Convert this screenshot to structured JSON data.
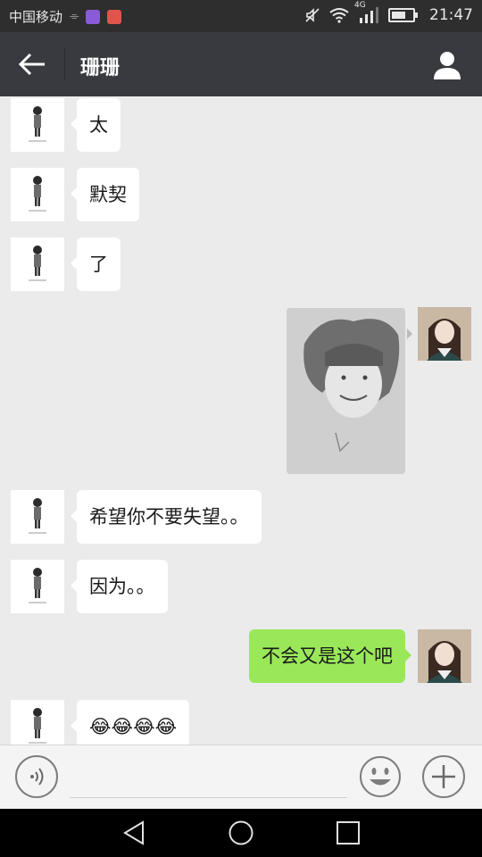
{
  "status_bar": {
    "carrier": "中国移动",
    "time": "21:47",
    "network": "4G",
    "battery_level": 0.7
  },
  "header": {
    "title": "珊珊"
  },
  "messages": [
    {
      "side": "left",
      "type": "text",
      "text": "太"
    },
    {
      "side": "left",
      "type": "text",
      "text": "默契"
    },
    {
      "side": "left",
      "type": "text",
      "text": "了"
    },
    {
      "side": "right",
      "type": "image",
      "alt": ""
    },
    {
      "side": "left",
      "type": "text",
      "text": "希望你不要失望。。"
    },
    {
      "side": "left",
      "type": "text",
      "text": "因为。。"
    },
    {
      "side": "right",
      "type": "text",
      "text": "不会又是这个吧"
    },
    {
      "side": "left",
      "type": "text",
      "text": "😂😂😂😂"
    }
  ],
  "colors": {
    "status_bar_bg": "#2e2e2e",
    "title_bar_bg": "#393a3f",
    "chat_bg": "#ebebeb",
    "incoming_bubble": "#ffffff",
    "outgoing_bubble": "#9ae85a"
  },
  "icons": {
    "back": "arrow-left-icon",
    "contact": "person-icon",
    "voice": "voice-icon",
    "emoji": "smiley-icon",
    "more": "plus-icon"
  }
}
